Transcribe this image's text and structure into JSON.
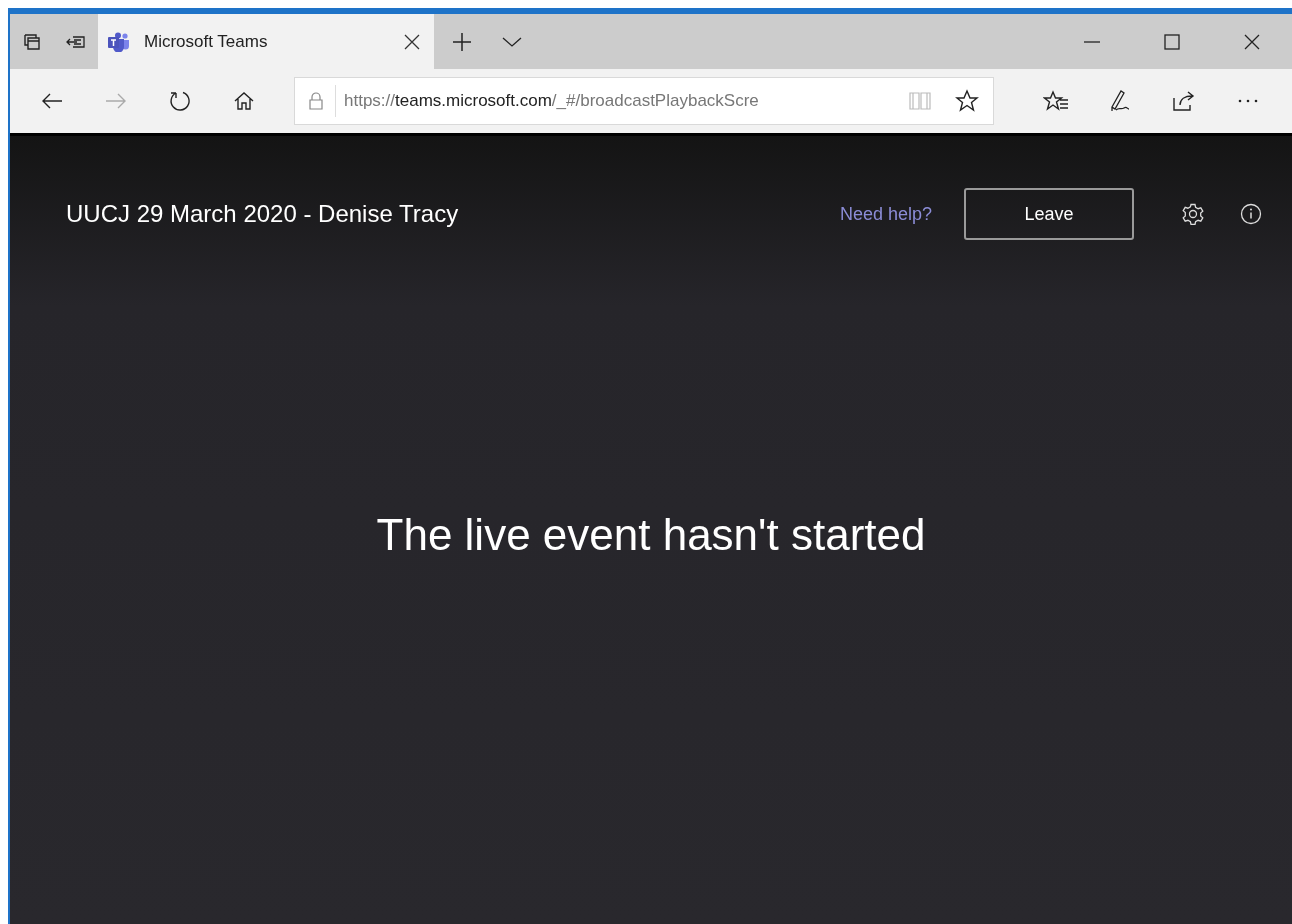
{
  "browser": {
    "tabs": [
      {
        "title": "Microsoft Teams",
        "selected": true
      }
    ],
    "address": {
      "scheme": "https://",
      "host": "teams.microsoft.com",
      "path": "/_#/broadcastPlaybackScre"
    }
  },
  "event": {
    "title": "UUCJ 29 March 2020 - Denise Tracy",
    "help_link": "Need help?",
    "leave_button": "Leave",
    "message": "The live event hasn't started"
  }
}
